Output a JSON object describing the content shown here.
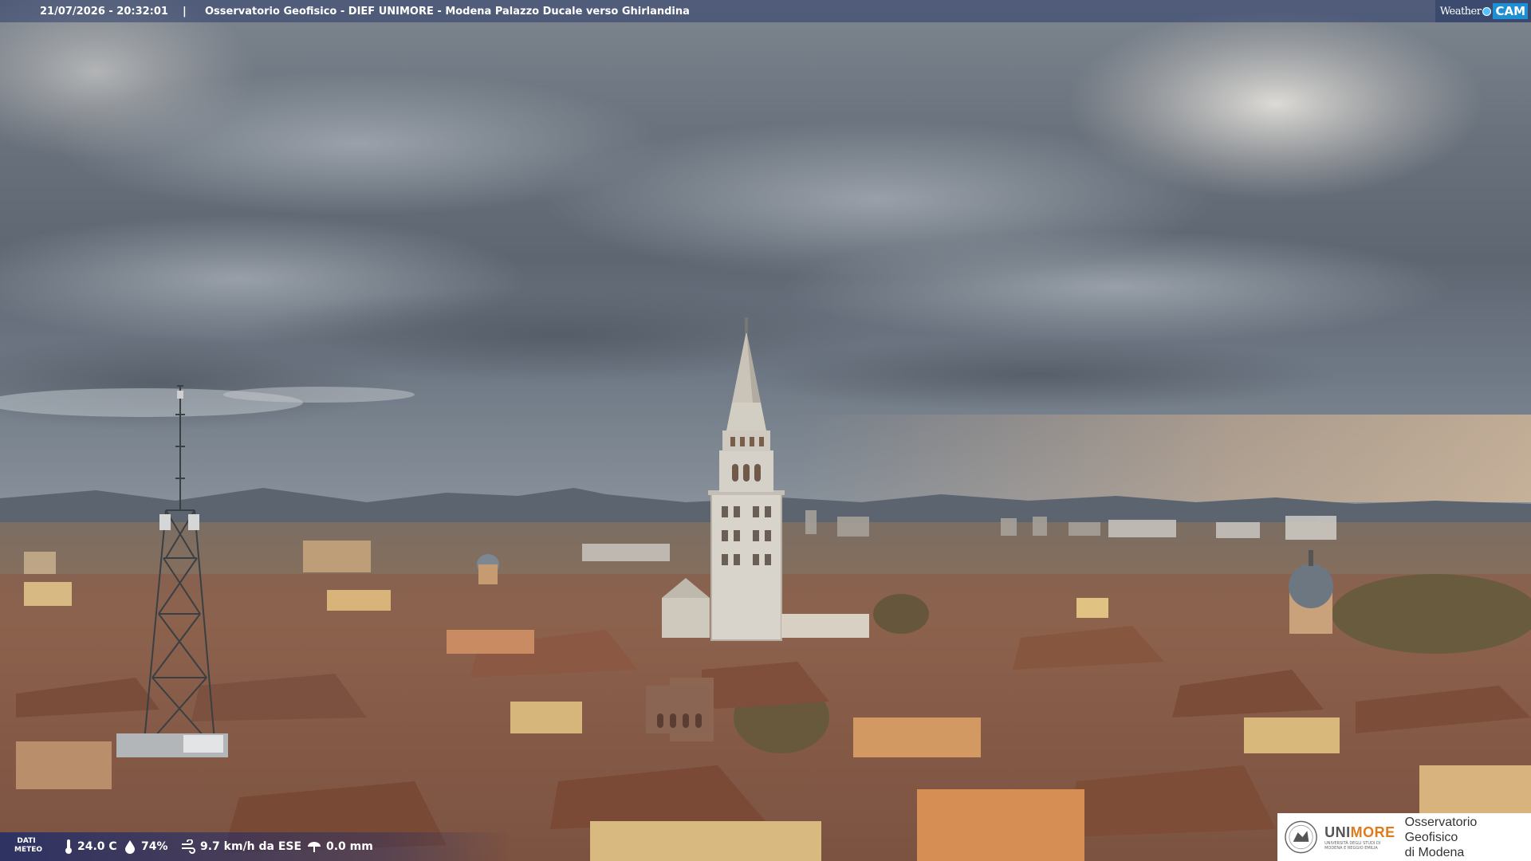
{
  "overlay": {
    "timestamp": "21/07/2026 - 20:32:01",
    "separator": "|",
    "title": "Osservatorio Geofisico - DIEF UNIMORE - Modena Palazzo Ducale verso Ghirlandina"
  },
  "watermark": {
    "word": "Weather",
    "cam": "CAM"
  },
  "meteo": {
    "label": "DATI METEO",
    "temperature": "24.0 C",
    "humidity": "74%",
    "wind": "9.7 km/h da ESE",
    "rain": "0.0 mm",
    "icons": [
      "thermometer-icon",
      "humidity-drop-icon",
      "wind-icon",
      "rain-icon"
    ]
  },
  "logo": {
    "brand_a": "UNI",
    "brand_b": "MORE",
    "university": "UNIVERSITÀ DEGLI STUDI DI MODENA E REGGIO EMILIA",
    "observatory_line1": "Osservatorio Geofisico",
    "observatory_line2": "di Modena"
  },
  "colors": {
    "brand_orange": "#e07b1b",
    "overlay_blue": "#12265c",
    "sky_cloud": "#8a929c",
    "roof_terracotta": "#8a5a45"
  }
}
